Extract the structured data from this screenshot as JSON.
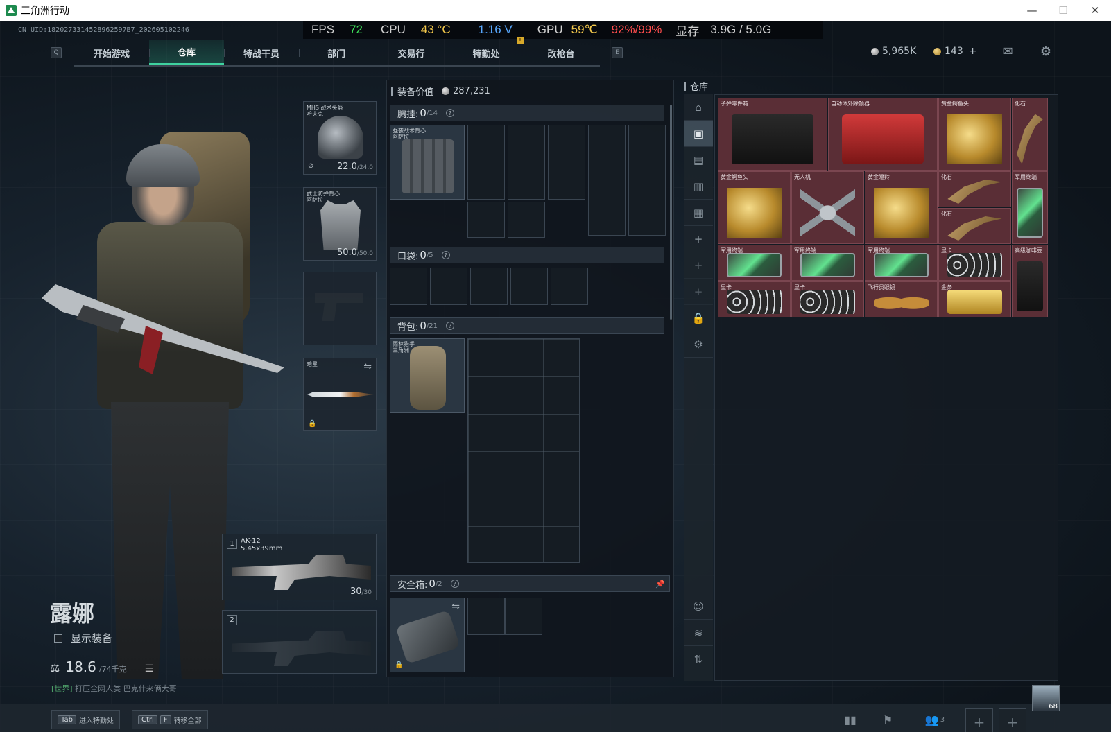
{
  "window": {
    "title": "三角洲行动",
    "min": "—",
    "max": "☐",
    "close": "✕"
  },
  "uid": "CN UID:1820273314528962597B7_202605102246",
  "perf": {
    "fps_label": "FPS",
    "fps": "72",
    "cpu_label": "CPU",
    "cpu_temp": "43 °C",
    "cpu_volt": "1.16 V",
    "gpu_label": "GPU",
    "gpu_temp": "59℃",
    "gpu_usage": "92%/99%",
    "vram_label": "显存",
    "vram": "3.9G / 5.0G",
    "warn": "!"
  },
  "nav": {
    "key_left": "Q",
    "key_right": "E",
    "tabs": [
      {
        "label": "开始游戏"
      },
      {
        "label": "仓库"
      },
      {
        "label": "特战干员"
      },
      {
        "label": "部门"
      },
      {
        "label": "交易行"
      },
      {
        "label": "特勤处"
      },
      {
        "label": "改枪台"
      }
    ],
    "active_tab": 1
  },
  "currency": {
    "silver": "5,965K",
    "gold": "143",
    "add": "+"
  },
  "character": {
    "name": "露娜",
    "show_equipment": "显示装备",
    "weight": "18.6",
    "weight_cap": "/74千克",
    "chat_channel": "[世界]",
    "chat_msg": "打压全网人类   巴克什来俩大哥"
  },
  "gear": {
    "helmet": {
      "label": "MHS 战术头盔\n哈夫克",
      "dur": "22.0",
      "dur_max": "/24.0"
    },
    "armor": {
      "label": "武士防弹背心\n阿萨拉",
      "dur": "50.0",
      "dur_max": "/50.0"
    },
    "melee": {
      "label": "暗星"
    }
  },
  "weapons": [
    {
      "slot": "1",
      "name": "AK-12",
      "caliber": "5.45x39mm",
      "ammo": "30",
      "ammo_max": "/30"
    },
    {
      "slot": "2"
    }
  ],
  "loadout": {
    "value_label": "装备价值",
    "value": "287,231",
    "chest": {
      "label": "胸挂:",
      "count": "0",
      "max": "/14",
      "item": "强袭战术背心\n阿萨拉"
    },
    "pocket": {
      "label": "口袋:",
      "count": "0",
      "max": "/5"
    },
    "backpack": {
      "label": "背包:",
      "count": "0",
      "max": "/21",
      "item": "雨林猎手\n三角洲"
    },
    "safebox": {
      "label": "安全箱:",
      "count": "0",
      "max": "/2"
    },
    "help": "?"
  },
  "warehouse": {
    "title": "仓库",
    "items": [
      {
        "name": "子弹零件箱",
        "art": "dark"
      },
      {
        "name": "自动体外除颤器",
        "art": "red"
      },
      {
        "name": "黄金鳄鱼头",
        "art": "gold"
      },
      {
        "name": "化石",
        "art": "fossil"
      },
      {
        "name": "黄金鳄鱼头",
        "art": "gold"
      },
      {
        "name": "无人机",
        "art": "drone"
      },
      {
        "name": "黄金瞪羚",
        "art": "gold"
      },
      {
        "name": "化石",
        "art": "fossil"
      },
      {
        "name": "军用终端",
        "art": "green"
      },
      {
        "name": "化石",
        "art": "fossil"
      },
      {
        "name": "军用终端",
        "art": "green"
      },
      {
        "name": "军用终端",
        "art": "green"
      },
      {
        "name": "军用终端",
        "art": "green"
      },
      {
        "name": "显卡",
        "art": "gpu"
      },
      {
        "name": "高级咖啡豆",
        "art": "dark"
      },
      {
        "name": "显卡",
        "art": "gpu"
      },
      {
        "name": "显卡",
        "art": "gpu"
      },
      {
        "name": "飞行员眼镜",
        "art": "glasses"
      },
      {
        "name": "金条",
        "art": "bar"
      }
    ]
  },
  "bottom": {
    "hint1_key": "Tab",
    "hint1": "进入特勤处",
    "hint2_key1": "Ctrl",
    "hint2_key2": "F",
    "hint2": "转移全部",
    "friends": "3",
    "level": "68"
  }
}
